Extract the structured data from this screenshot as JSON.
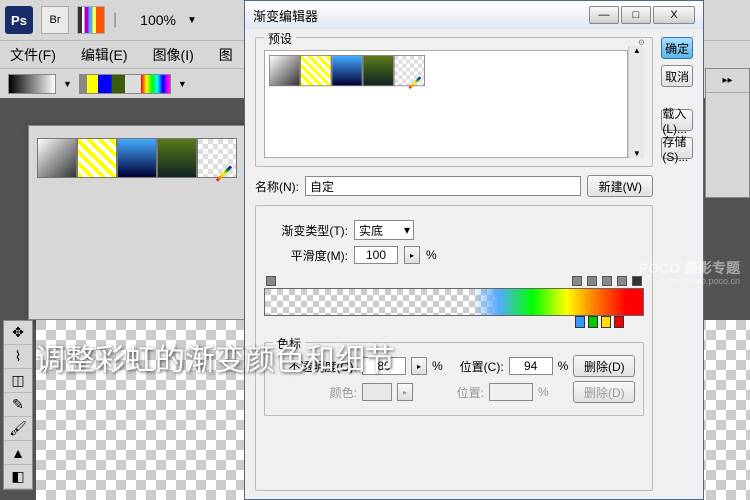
{
  "app": {
    "icon": "Ps",
    "bridge": "Br",
    "zoom": "100%"
  },
  "menu": {
    "file": "文件(F)",
    "edit": "编辑(E)",
    "image": "图像(I)",
    "layer": "图"
  },
  "dialog": {
    "title": "渐变编辑器",
    "presets_label": "预设",
    "ok": "确定",
    "cancel": "取消",
    "load": "载入(L)...",
    "save": "存储(S)...",
    "name_label": "名称(N):",
    "name_value": "自定",
    "new_btn": "新建(W)",
    "type_label": "渐变类型(T):",
    "type_value": "实底",
    "smooth_label": "平滑度(M):",
    "smooth_value": "100",
    "percent": "%",
    "stops_label": "色标",
    "opacity_label": "不透明度(O):",
    "opacity_value": "80",
    "location_label": "位置(C):",
    "location_value": "94",
    "location2_label": "位置:",
    "color_label": "颜色:",
    "delete": "删除(D)"
  },
  "caption": "调整彩虹的渐变颜色和细节",
  "watermark": {
    "main": "POCO 摄影专题",
    "sub": "http://photo.poco.cn"
  }
}
